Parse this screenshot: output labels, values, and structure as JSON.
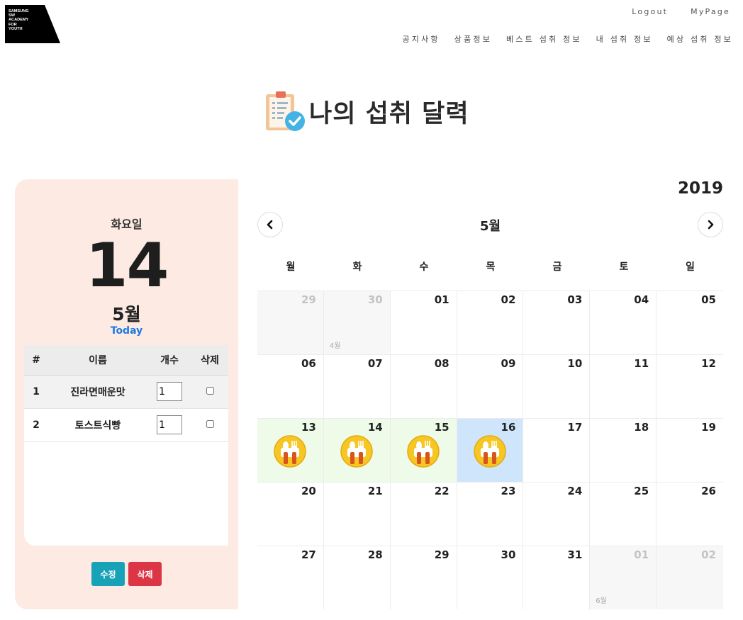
{
  "logo": {
    "lines": [
      "SAMSUNG",
      "SW",
      "ACADEMY",
      "FOR",
      "YOUTH"
    ]
  },
  "auth": {
    "logout": "Logout",
    "mypage": "MyPage"
  },
  "nav": [
    "공지사항",
    "상품정보",
    "베스트 섭취 정보",
    "내 섭취 정보",
    "예상 섭취 정보"
  ],
  "page": {
    "title": "나의 섭취 달력",
    "title_icon": "clipboard-check-icon"
  },
  "today_panel": {
    "weekday": "화요일",
    "day": "14",
    "month": "5월",
    "today_label": "Today",
    "table": {
      "headers": [
        "#",
        "이름",
        "개수",
        "삭제"
      ],
      "rows": [
        {
          "no": "1",
          "name": "진라면매운맛",
          "count": "1"
        },
        {
          "no": "2",
          "name": "토스트식빵",
          "count": "1"
        }
      ]
    },
    "buttons": {
      "edit": "수정",
      "delete": "삭제"
    },
    "colors": {
      "panel_bg": "#fdebe3",
      "edit": "#17a2b8",
      "delete": "#dc3545",
      "today": "#1f7ae0"
    }
  },
  "calendar": {
    "year": "2019",
    "month": "5월",
    "prev_icon": "chevron-left-icon",
    "next_icon": "chevron-right-icon",
    "weekdays": [
      "월",
      "화",
      "수",
      "목",
      "금",
      "토",
      "일"
    ],
    "meal_icon": "fork-spoon-icon",
    "colors": {
      "eaten": "#edfbe8",
      "selected": "#cfe5fb",
      "other_month": "#f7f7f7"
    },
    "days": [
      {
        "n": "29",
        "other": true
      },
      {
        "n": "30",
        "other": true,
        "label": "4월"
      },
      {
        "n": "01"
      },
      {
        "n": "02"
      },
      {
        "n": "03"
      },
      {
        "n": "04"
      },
      {
        "n": "05"
      },
      {
        "n": "06"
      },
      {
        "n": "07"
      },
      {
        "n": "08"
      },
      {
        "n": "09"
      },
      {
        "n": "10"
      },
      {
        "n": "11"
      },
      {
        "n": "12"
      },
      {
        "n": "13",
        "meal": true
      },
      {
        "n": "14",
        "meal": true
      },
      {
        "n": "15",
        "meal": true
      },
      {
        "n": "16",
        "meal": true,
        "selected": true
      },
      {
        "n": "17"
      },
      {
        "n": "18"
      },
      {
        "n": "19"
      },
      {
        "n": "20"
      },
      {
        "n": "21"
      },
      {
        "n": "22"
      },
      {
        "n": "23"
      },
      {
        "n": "24"
      },
      {
        "n": "25"
      },
      {
        "n": "26"
      },
      {
        "n": "27"
      },
      {
        "n": "28"
      },
      {
        "n": "29"
      },
      {
        "n": "30"
      },
      {
        "n": "31"
      },
      {
        "n": "01",
        "other": true,
        "label": "6월"
      },
      {
        "n": "02",
        "other": true
      }
    ]
  }
}
